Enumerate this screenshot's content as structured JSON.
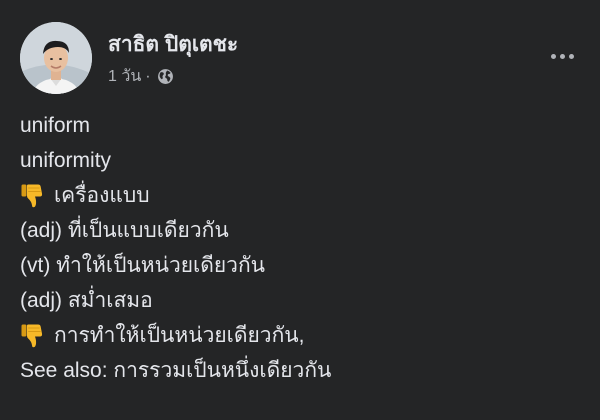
{
  "post": {
    "author": "สาธิต ปิตุเตชะ",
    "time": "1 วัน",
    "separator": "·",
    "privacy_icon": "globe-icon",
    "more_icon": "more-options-icon",
    "lines": [
      {
        "text": "uniform",
        "icon": null
      },
      {
        "text": "uniformity",
        "icon": null
      },
      {
        "text": "เครื่องแบบ",
        "icon": "thumbs-down-emoji"
      },
      {
        "text": "(adj) ที่เป็นแบบเดียวกัน",
        "icon": null
      },
      {
        "text": "(vt) ทำให้เป็นหน่วยเดียวกัน",
        "icon": null
      },
      {
        "text": "(adj) สม่ำเสมอ",
        "icon": null
      },
      {
        "text": "การทำให้เป็นหน่วยเดียวกัน,",
        "icon": "thumbs-down-emoji"
      },
      {
        "text": "See also: การรวมเป็นหนึ่งเดียวกัน",
        "icon": null
      }
    ]
  },
  "colors": {
    "background": "#242526",
    "primary_text": "#e4e6eb",
    "secondary_text": "#b0b3b8",
    "emoji": "#f7b928"
  }
}
